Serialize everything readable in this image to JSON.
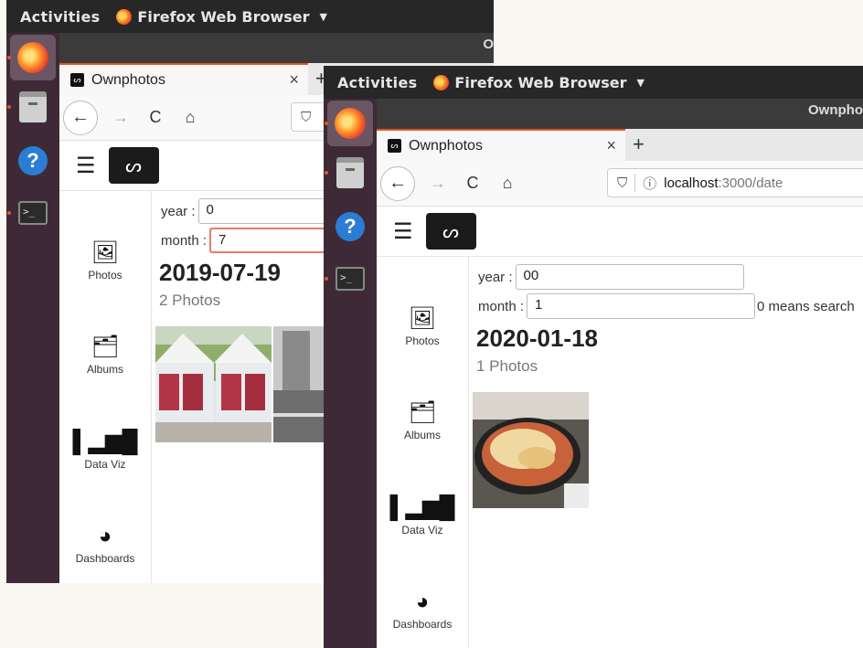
{
  "back": {
    "topbar": {
      "activities": "Activities",
      "app": "Firefox Web Browser",
      "title_fragment": "O"
    },
    "tab": {
      "title": "Ownphotos",
      "close": "×",
      "new": "+"
    },
    "nav": {
      "back": "←",
      "forward": "→",
      "reload": "C",
      "home": "⌂",
      "shield": "⛉"
    },
    "filters": {
      "year_label": "year :",
      "year_value": "0",
      "month_label": "month :",
      "month_value": "7"
    },
    "group": {
      "date": "2019-07-19",
      "count": "2 Photos"
    },
    "sidebar": [
      {
        "label": "Photos",
        "icon": "image-icon"
      },
      {
        "label": "Albums",
        "icon": "albums-icon"
      },
      {
        "label": "Data Viz",
        "icon": "bar-chart-icon"
      },
      {
        "label": "Dashboards",
        "icon": "dashboard-gauge-icon"
      }
    ]
  },
  "front": {
    "topbar": {
      "activities": "Activities",
      "app": "Firefox Web Browser",
      "title_fragment": "Ownpho"
    },
    "tab": {
      "title": "Ownphotos",
      "close": "×",
      "new": "+"
    },
    "nav": {
      "back": "←",
      "forward": "→",
      "reload": "C",
      "home": "⌂",
      "shield": "⛉",
      "info": "ⓘ"
    },
    "url": {
      "host": "localhost",
      "path": ":3000/date"
    },
    "filters": {
      "year_label": "year :",
      "year_value": "00",
      "month_label": "month :",
      "month_value": "1",
      "hint": "0 means search"
    },
    "group": {
      "date": "2020-01-18",
      "count": "1 Photos"
    },
    "sidebar": [
      {
        "label": "Photos",
        "icon": "image-icon"
      },
      {
        "label": "Albums",
        "icon": "albums-icon"
      },
      {
        "label": "Data Viz",
        "icon": "bar-chart-icon"
      },
      {
        "label": "Dashboards",
        "icon": "dashboard-gauge-icon"
      }
    ]
  },
  "dock": [
    {
      "icon": "firefox-icon",
      "active": true
    },
    {
      "icon": "files-icon",
      "active": false
    },
    {
      "icon": "help-icon",
      "active": false
    },
    {
      "icon": "terminal-icon",
      "active": false
    }
  ],
  "colors": {
    "topbar": "#272727",
    "dock": "#3e2a36",
    "accent": "#e95420",
    "focus_border": "#e27c5f",
    "page_bg": "#faf6f2"
  }
}
